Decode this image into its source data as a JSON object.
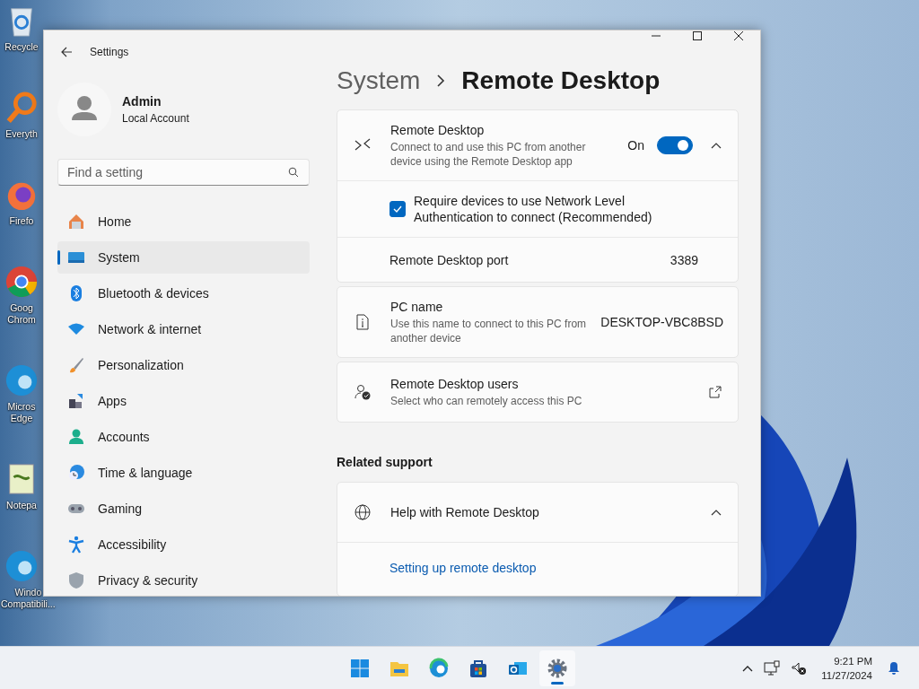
{
  "desktop": {
    "icons": [
      {
        "kind": "recycle",
        "lines": [
          "Recycle"
        ]
      },
      {
        "kind": "search",
        "lines": [
          "Everyth"
        ]
      },
      {
        "kind": "firefox",
        "lines": [
          "Firefo"
        ]
      },
      {
        "kind": "chrome",
        "lines": [
          "Goog",
          "Chrom"
        ]
      },
      {
        "kind": "edge",
        "lines": [
          "Micros",
          "Edge"
        ]
      },
      {
        "kind": "notepad",
        "lines": [
          "Notepa"
        ]
      },
      {
        "kind": "edge",
        "lines": [
          "Windo",
          "Compatibili..."
        ]
      }
    ]
  },
  "window": {
    "title": "Settings"
  },
  "user": {
    "name": "Admin",
    "account_type": "Local Account"
  },
  "search": {
    "placeholder": "Find a setting"
  },
  "sidebar": {
    "items": [
      {
        "kind": "home",
        "label": "Home",
        "selected": false
      },
      {
        "kind": "system",
        "label": "System",
        "selected": true
      },
      {
        "kind": "bluetooth",
        "label": "Bluetooth & devices",
        "selected": false
      },
      {
        "kind": "network",
        "label": "Network & internet",
        "selected": false
      },
      {
        "kind": "brush",
        "label": "Personalization",
        "selected": false
      },
      {
        "kind": "apps",
        "label": "Apps",
        "selected": false
      },
      {
        "kind": "accounts",
        "label": "Accounts",
        "selected": false
      },
      {
        "kind": "time",
        "label": "Time & language",
        "selected": false
      },
      {
        "kind": "gaming",
        "label": "Gaming",
        "selected": false
      },
      {
        "kind": "accessibility",
        "label": "Accessibility",
        "selected": false
      },
      {
        "kind": "privacy",
        "label": "Privacy & security",
        "selected": false
      }
    ]
  },
  "breadcrumb": {
    "parent": "System",
    "current": "Remote Desktop"
  },
  "remote_desktop": {
    "title": "Remote Desktop",
    "description": "Connect to and use this PC from another device using the Remote Desktop app",
    "toggle_label": "On",
    "on": true,
    "expanded": true,
    "nla": {
      "label": "Require devices to use Network Level Authentication to connect (Recommended)",
      "checked": true
    },
    "port": {
      "label": "Remote Desktop port",
      "value": "3389"
    }
  },
  "pc_name": {
    "title": "PC name",
    "description": "Use this name to connect to this PC from another device",
    "value": "DESKTOP-VBC8BSD"
  },
  "users": {
    "title": "Remote Desktop users",
    "description": "Select who can remotely access this PC"
  },
  "related_support": {
    "heading": "Related support",
    "help": {
      "title": "Help with Remote Desktop",
      "expanded": true,
      "link": "Setting up remote desktop"
    }
  },
  "taskbar": {
    "apps": [
      {
        "kind": "start",
        "selected": false
      },
      {
        "kind": "files",
        "selected": false
      },
      {
        "kind": "edge",
        "selected": false
      },
      {
        "kind": "store",
        "selected": false
      },
      {
        "kind": "mail",
        "selected": false
      },
      {
        "kind": "settings",
        "selected": true
      }
    ],
    "clock": {
      "time": "9:21 PM",
      "date": "11/27/2024"
    }
  }
}
